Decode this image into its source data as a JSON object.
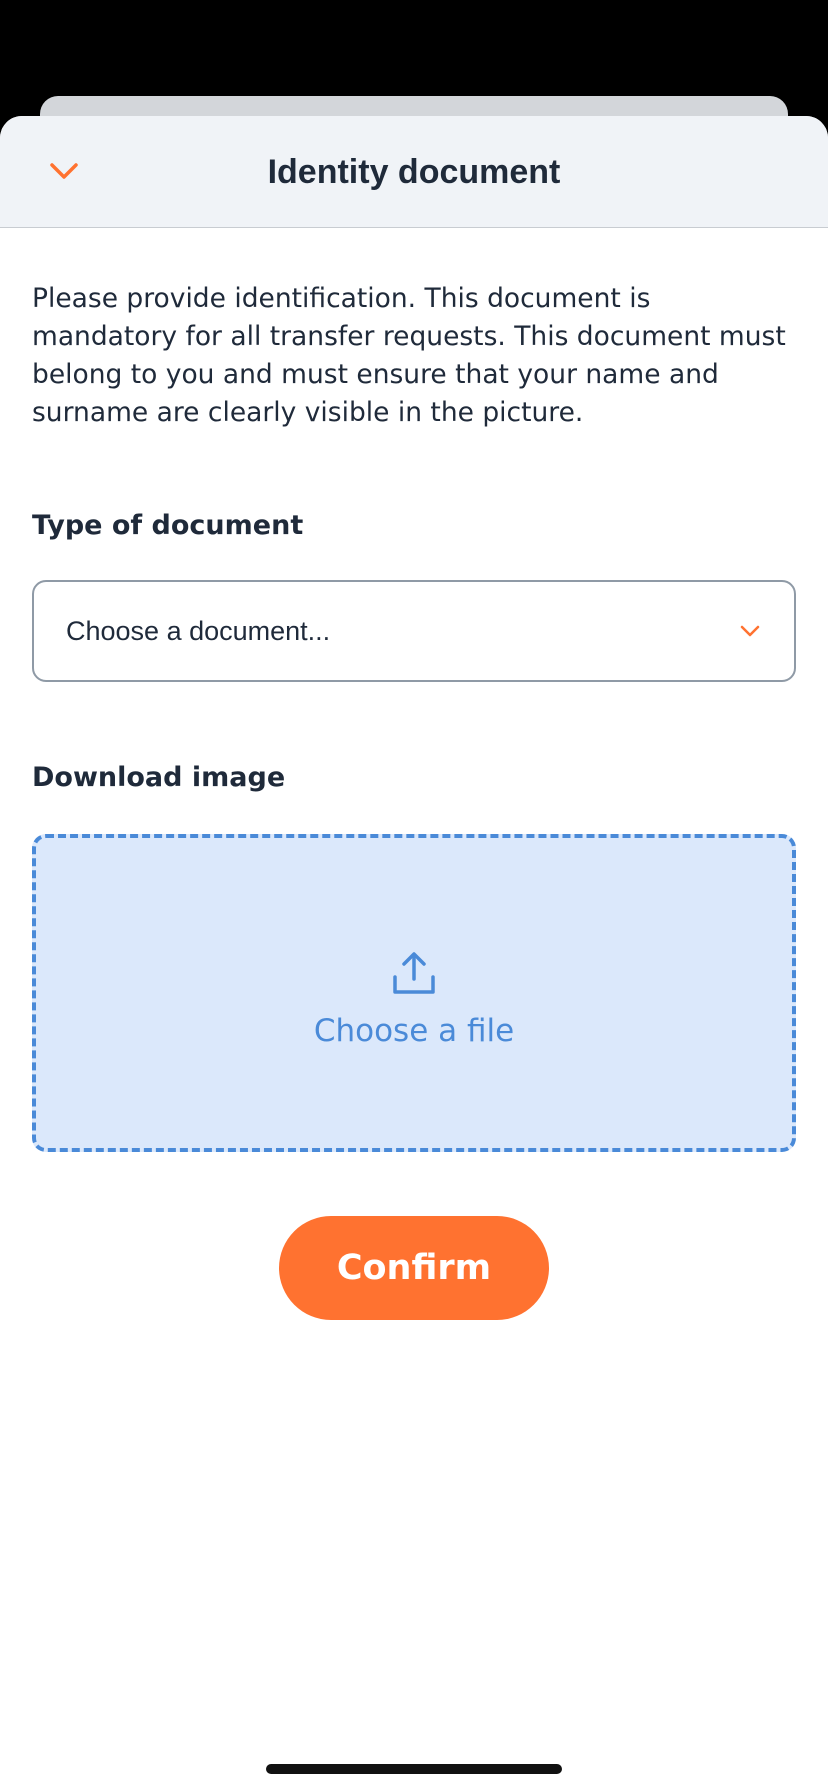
{
  "header": {
    "title": "Identity document",
    "close_icon": "chevron-down-icon"
  },
  "intro_text": "Please provide identification. This document is mandatory for all transfer requests. This document must belong to you and must ensure that your name and surname are clearly visible in the picture.",
  "document_type": {
    "label": "Type of document",
    "placeholder": "Choose a document...",
    "chevron_icon": "chevron-down-icon"
  },
  "upload": {
    "label": "Download image",
    "icon": "upload-icon",
    "text": "Choose a file"
  },
  "confirm_label": "Confirm",
  "colors": {
    "accent": "#ff7230",
    "upload_blue": "#4a8ad8",
    "upload_bg": "#dbe8fb",
    "header_bg": "#f0f3f7",
    "text": "#1f2a3a"
  }
}
